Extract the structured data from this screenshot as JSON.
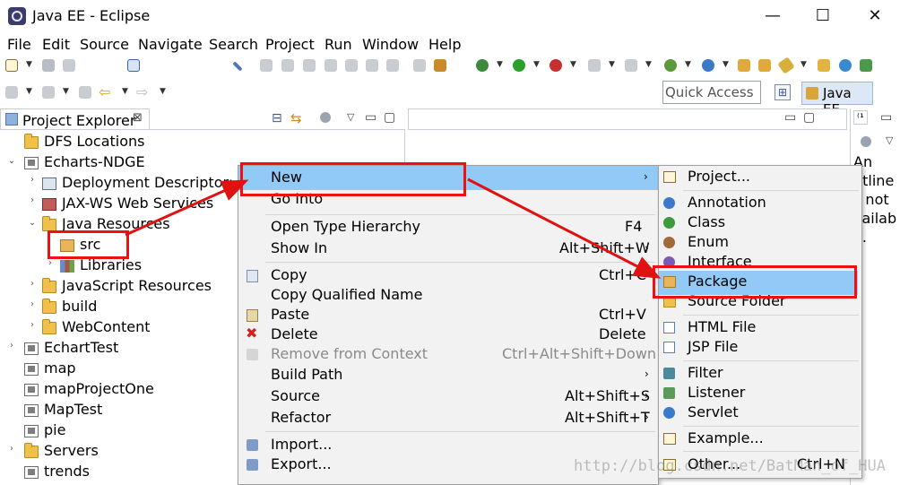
{
  "window": {
    "title": "Java EE - Eclipse",
    "minimize": "—",
    "maximize": "☐",
    "close": "✕"
  },
  "menubar": [
    "File",
    "Edit",
    "Source",
    "Navigate",
    "Search",
    "Project",
    "Run",
    "Window",
    "Help"
  ],
  "quick_access": {
    "placeholder": "Quick Access"
  },
  "perspective": {
    "label": "Java EE"
  },
  "project_explorer": {
    "tab_title": "Project Explorer",
    "tab_close": "⊠",
    "tree": [
      {
        "label": "DFS Locations",
        "icon": "folder"
      },
      {
        "label": "Echarts-NDGE",
        "icon": "project"
      },
      {
        "label": "Deployment Descriptor: Ec",
        "icon": "descriptor"
      },
      {
        "label": "JAX-WS Web Services",
        "icon": "webservice"
      },
      {
        "label": "Java Resources",
        "icon": "folder"
      },
      {
        "label": "src",
        "icon": "package-folder"
      },
      {
        "label": "Libraries",
        "icon": "libraries"
      },
      {
        "label": "JavaScript Resources",
        "icon": "folder"
      },
      {
        "label": "build",
        "icon": "folder"
      },
      {
        "label": "WebContent",
        "icon": "folder"
      },
      {
        "label": "EchartTest",
        "icon": "project"
      },
      {
        "label": "map",
        "icon": "project"
      },
      {
        "label": "mapProjectOne",
        "icon": "project"
      },
      {
        "label": "MapTest",
        "icon": "project"
      },
      {
        "label": "pie",
        "icon": "project"
      },
      {
        "label": "Servers",
        "icon": "folder"
      },
      {
        "label": "trends",
        "icon": "project"
      }
    ]
  },
  "outline_partial": [
    "An",
    "utline",
    "s not",
    "vailab",
    "e."
  ],
  "context_menu": [
    {
      "label": "New",
      "shortcut": "",
      "submenu": true,
      "disabled": false
    },
    {
      "label": "Go Into",
      "shortcut": "",
      "submenu": false,
      "disabled": false
    },
    {
      "label": "Open Type Hierarchy",
      "shortcut": "F4",
      "submenu": false,
      "disabled": false
    },
    {
      "label": "Show In",
      "shortcut": "Alt+Shift+W",
      "submenu": true,
      "disabled": false
    },
    {
      "label": "Copy",
      "shortcut": "Ctrl+C",
      "submenu": false,
      "disabled": false
    },
    {
      "label": "Copy Qualified Name",
      "shortcut": "",
      "submenu": false,
      "disabled": false
    },
    {
      "label": "Paste",
      "shortcut": "Ctrl+V",
      "submenu": false,
      "disabled": false
    },
    {
      "label": "Delete",
      "shortcut": "Delete",
      "submenu": false,
      "disabled": false
    },
    {
      "label": "Remove from Context",
      "shortcut": "Ctrl+Alt+Shift+Down",
      "submenu": false,
      "disabled": true
    },
    {
      "label": "Build Path",
      "shortcut": "",
      "submenu": true,
      "disabled": false
    },
    {
      "label": "Source",
      "shortcut": "Alt+Shift+S",
      "submenu": true,
      "disabled": false
    },
    {
      "label": "Refactor",
      "shortcut": "Alt+Shift+T",
      "submenu": true,
      "disabled": false
    },
    {
      "label": "Import...",
      "shortcut": "",
      "submenu": false,
      "disabled": false
    },
    {
      "label": "Export...",
      "shortcut": "",
      "submenu": false,
      "disabled": false
    }
  ],
  "new_submenu": [
    {
      "label": "Project...",
      "shortcut": ""
    },
    {
      "label": "Annotation",
      "shortcut": ""
    },
    {
      "label": "Class",
      "shortcut": ""
    },
    {
      "label": "Enum",
      "shortcut": ""
    },
    {
      "label": "Interface",
      "shortcut": ""
    },
    {
      "label": "Package",
      "shortcut": ""
    },
    {
      "label": "Source Folder",
      "shortcut": ""
    },
    {
      "label": "HTML File",
      "shortcut": ""
    },
    {
      "label": "JSP File",
      "shortcut": ""
    },
    {
      "label": "Filter",
      "shortcut": ""
    },
    {
      "label": "Listener",
      "shortcut": ""
    },
    {
      "label": "Servlet",
      "shortcut": ""
    },
    {
      "label": "Example...",
      "shortcut": ""
    },
    {
      "label": "Other...",
      "shortcut": "Ctrl+N"
    }
  ],
  "watermark": "http://blog.csdn.net/BatMan_of_HUA",
  "colors": {
    "highlight": "#91c9f7",
    "annotation_red": "#e11111",
    "menu_bg": "#f2f2f2"
  }
}
